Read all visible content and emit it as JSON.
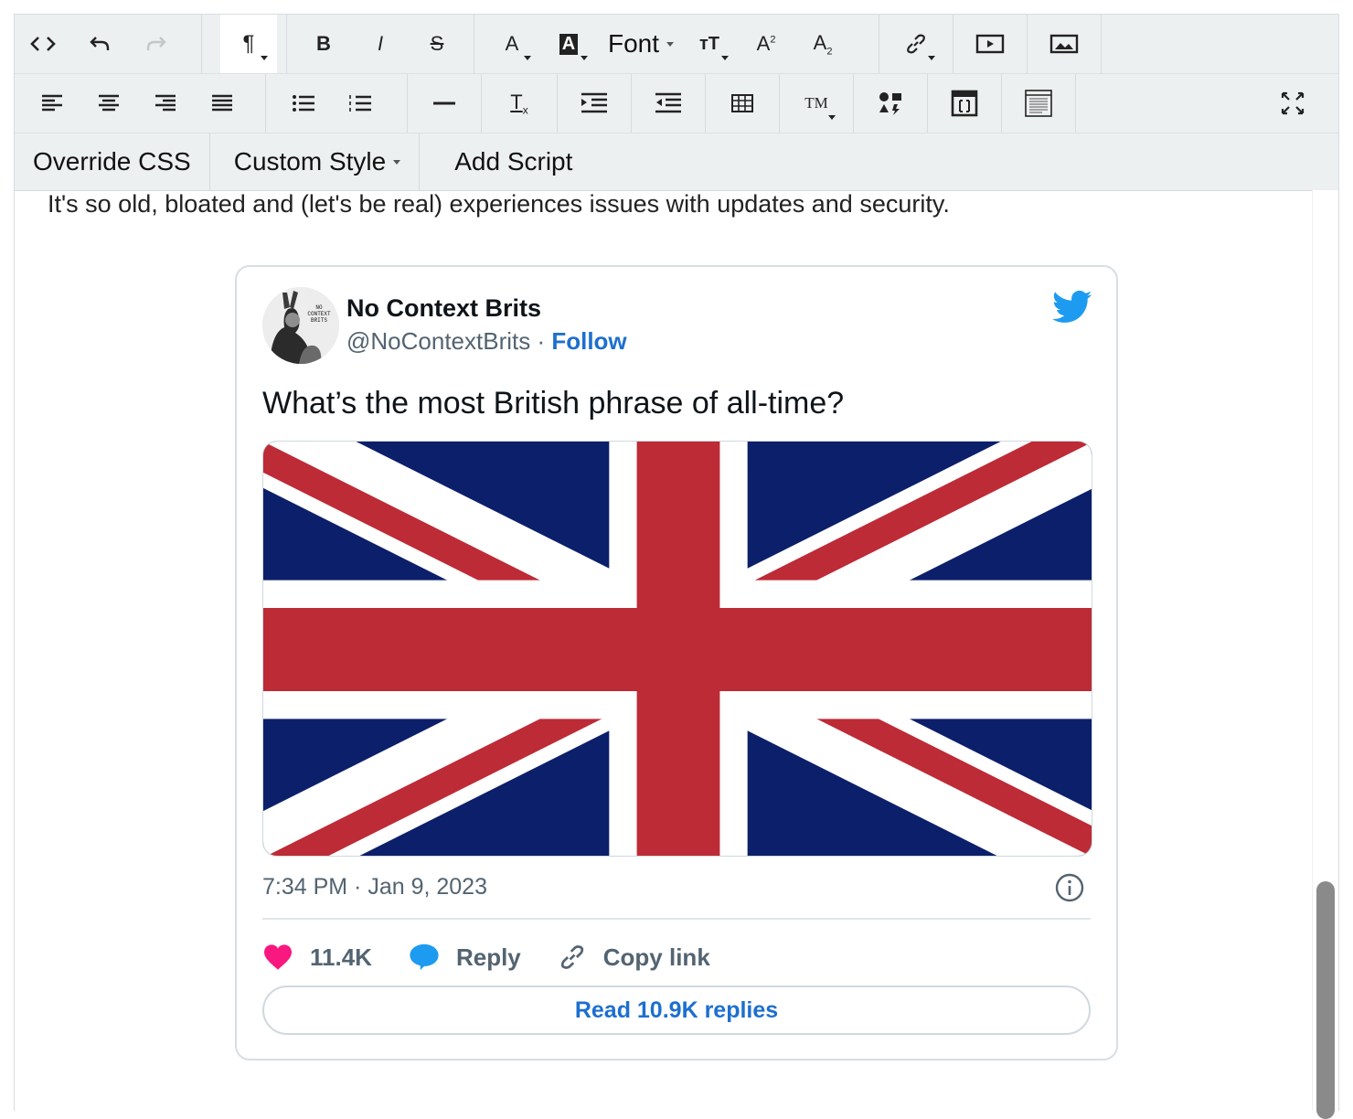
{
  "toolbar": {
    "font_label": "Font",
    "row3": {
      "override_css": "Override CSS",
      "custom_style": "Custom Style",
      "add_script": "Add Script"
    }
  },
  "content": {
    "lead_text": "It's so old, bloated and (let's be real) experiences issues with updates and security."
  },
  "tweet": {
    "author_name": "No Context Brits",
    "handle": "@NoContextBrits",
    "separator": " · ",
    "follow_label": "Follow",
    "text": "What’s the most British phrase of all-time?",
    "timestamp": "7:34 PM · Jan 9, 2023",
    "likes": "11.4K",
    "reply_label": "Reply",
    "copy_link_label": "Copy link",
    "read_replies_label": "Read 10.9K replies",
    "avatar_text": [
      "NO",
      "CONTEXT",
      "BRITS"
    ],
    "colors": {
      "twitter_blue": "#1d9bf0",
      "link_blue": "#1d6fd0",
      "like_pink": "#f91880",
      "flag_blue": "#0c1f6b",
      "flag_red": "#bd2b36"
    }
  }
}
